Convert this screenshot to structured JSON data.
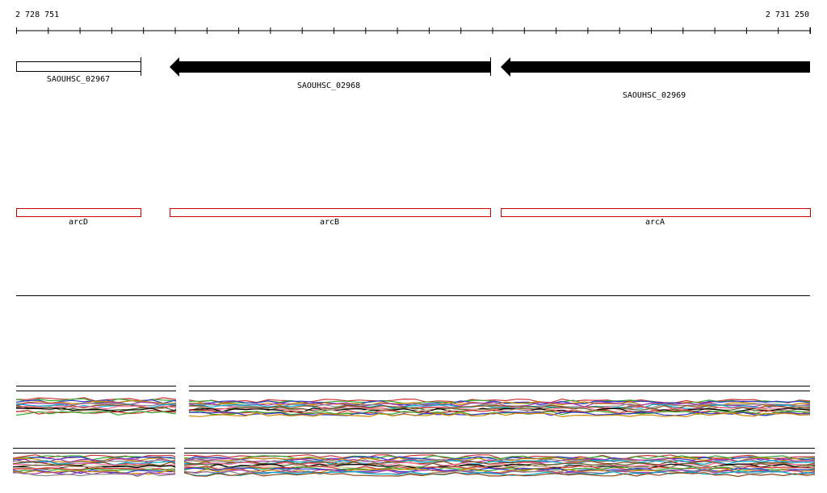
{
  "ruler": {
    "start_label": "2 728 751",
    "end_label": "2 731 250",
    "start": 2728751,
    "end": 2731250
  },
  "genes": [
    {
      "id": "SAOUHSC_02967",
      "style": "outline",
      "direction": "none"
    },
    {
      "id": "SAOUHSC_02968",
      "style": "filled",
      "direction": "reverse"
    },
    {
      "id": "SAOUHSC_02969",
      "style": "filled",
      "direction": "reverse"
    }
  ],
  "features": [
    {
      "name": "arcD"
    },
    {
      "name": "arcB"
    },
    {
      "name": "arcA"
    }
  ],
  "colors": {
    "gene_fill": "#000000",
    "feature_outline": "#cc0000",
    "track_line": "#000000",
    "trace_colors": [
      "#cc3333",
      "#33aa33",
      "#3333cc",
      "#cc8800",
      "#aa33aa",
      "#888888",
      "#00aacc",
      "#8b4513",
      "#ff6699",
      "#556b2f",
      "#000000",
      "#d2b48c"
    ]
  }
}
